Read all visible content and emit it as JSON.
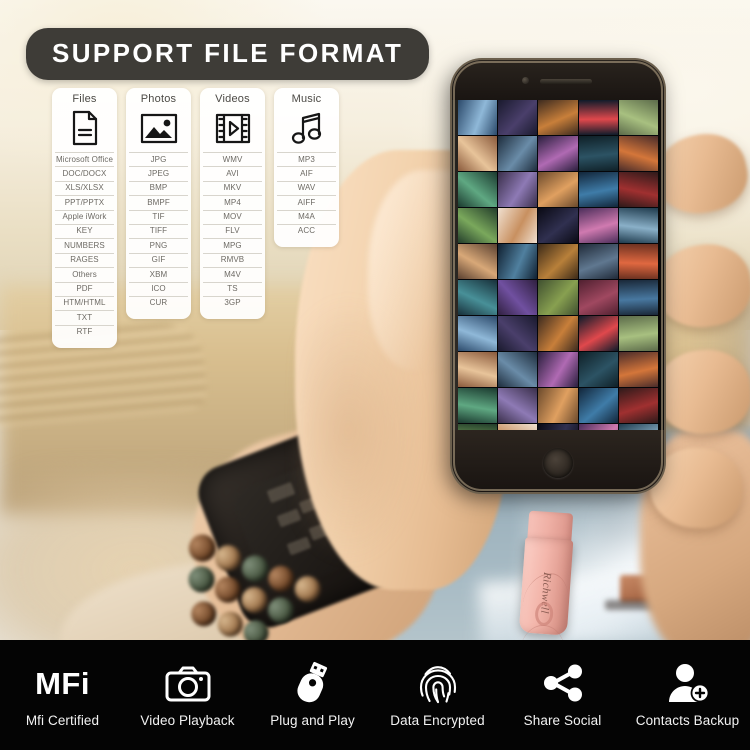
{
  "banner": {
    "title": "SUPPORT FILE FORMAT"
  },
  "colors": {
    "banner_bg": "#3e3c37",
    "card_bg": "#ffffff",
    "feature_bar_bg": "#040404",
    "usb_pink": "#f3b6ab",
    "text_dark": "#4c4a45"
  },
  "cards": [
    {
      "title": "Files",
      "icon": "document-icon",
      "formats": [
        "Microsoft Office",
        "DOC/DOCX",
        "XLS/XLSX",
        "PPT/PPTX",
        "Apple iWork",
        "KEY",
        "NUMBERS",
        "RAGES",
        "Others",
        "PDF",
        "HTM/HTML",
        "TXT",
        "RTF"
      ]
    },
    {
      "title": "Photos",
      "icon": "image-icon",
      "formats": [
        "JPG",
        "JPEG",
        "BMP",
        "BMPF",
        "TIF",
        "TIFF",
        "PNG",
        "GIF",
        "XBM",
        "ICO",
        "CUR"
      ]
    },
    {
      "title": "Videos",
      "icon": "film-play-icon",
      "formats": [
        "WMV",
        "AVI",
        "MKV",
        "MP4",
        "MOV",
        "FLV",
        "MPG",
        "RMVB",
        "M4V",
        "TS",
        "3GP"
      ]
    },
    {
      "title": "Music",
      "icon": "music-note-icon",
      "formats": [
        "MP3",
        "AIF",
        "WAV",
        "AIFF",
        "M4A",
        "ACC"
      ]
    }
  ],
  "usb_drive": {
    "brand": "Richwell"
  },
  "features": [
    {
      "label": "Mfi Certified",
      "icon": "mfi-text-icon",
      "glyph_text": "MFi"
    },
    {
      "label": "Video Playback",
      "icon": "camera-icon"
    },
    {
      "label": "Plug and Play",
      "icon": "usb-drive-icon"
    },
    {
      "label": "Data Encrypted",
      "icon": "fingerprint-icon"
    },
    {
      "label": "Share Social",
      "icon": "share-nodes-icon"
    },
    {
      "label": "Contacts Backup",
      "icon": "person-add-icon"
    }
  ],
  "phone": {
    "screen_content": "photo-gallery-grid",
    "thumbnail_columns": 5,
    "thumbnail_rows": 10
  }
}
